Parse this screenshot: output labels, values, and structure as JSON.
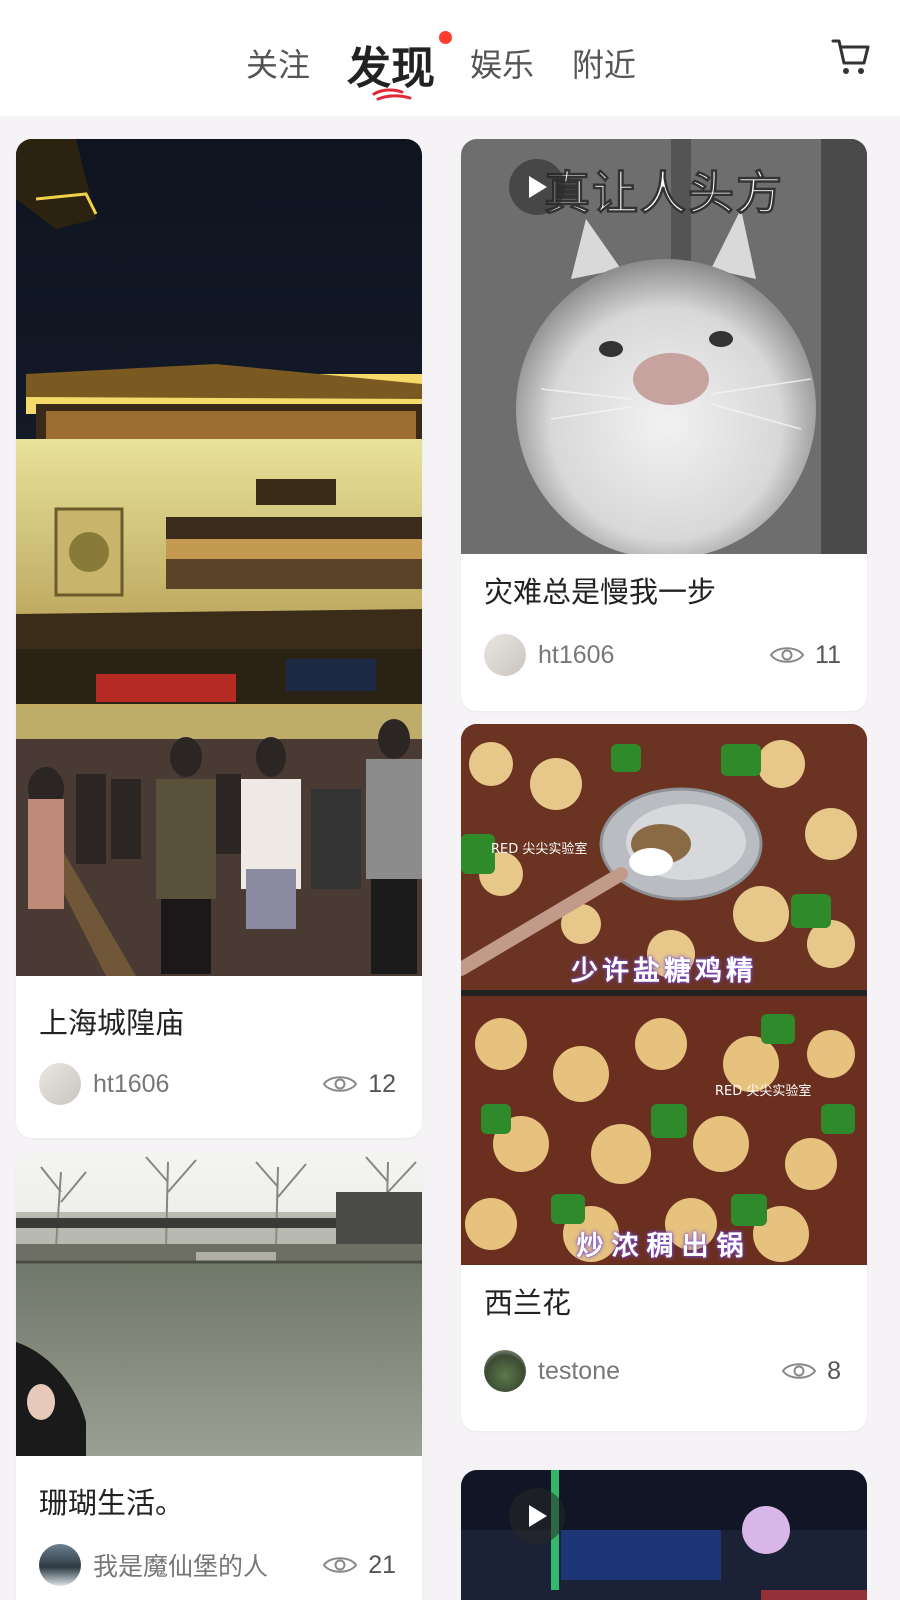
{
  "header": {
    "tabs": [
      {
        "label": "关注"
      },
      {
        "label": "发现"
      },
      {
        "label": "娱乐"
      },
      {
        "label": "附近"
      }
    ],
    "active_tab": "发现",
    "cart_icon": "cart-icon"
  },
  "feed": {
    "left": [
      {
        "title": "上海城隍庙",
        "author": "ht1606",
        "views": "12",
        "media": "photo"
      },
      {
        "title": "珊瑚生活。",
        "author": "我是魔仙堡的人",
        "views": "21",
        "media": "photo"
      }
    ],
    "right": [
      {
        "title": "灾难总是慢我一步",
        "author": "ht1606",
        "views": "11",
        "media": "video",
        "overlay_text": "真让人头方"
      },
      {
        "title": "西兰花",
        "author": "testone",
        "views": "8",
        "media": "photo",
        "overlay_text_1": "少许盐糖鸡精",
        "overlay_text_2": "炒浓稠出锅",
        "watermark": "RED 尖尖实验室"
      },
      {
        "media": "video"
      }
    ]
  },
  "colors": {
    "background": "#f5f3f5",
    "accent_dot": "#ff3b30",
    "underline": "#e0283a",
    "title_text": "#222222",
    "meta_text": "#777777"
  }
}
